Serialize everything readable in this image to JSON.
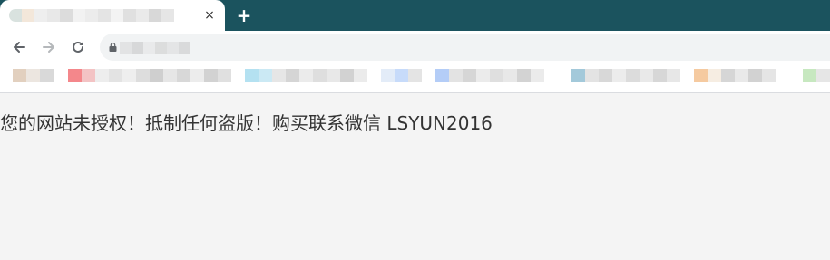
{
  "browser": {
    "tab": {
      "close_label": "×"
    },
    "new_tab_label": "+",
    "toolbar": {
      "back_icon": "arrow-left-icon",
      "forward_icon": "arrow-right-icon",
      "reload_icon": "reload-icon",
      "lock_icon": "lock-icon"
    }
  },
  "page": {
    "message": "您的网站未授权！抵制任何盗版！购买联系微信 LSYUN2016"
  },
  "colors": {
    "tabstrip": "#1b535e",
    "page_background": "#f4f4f4",
    "text": "#333333"
  }
}
